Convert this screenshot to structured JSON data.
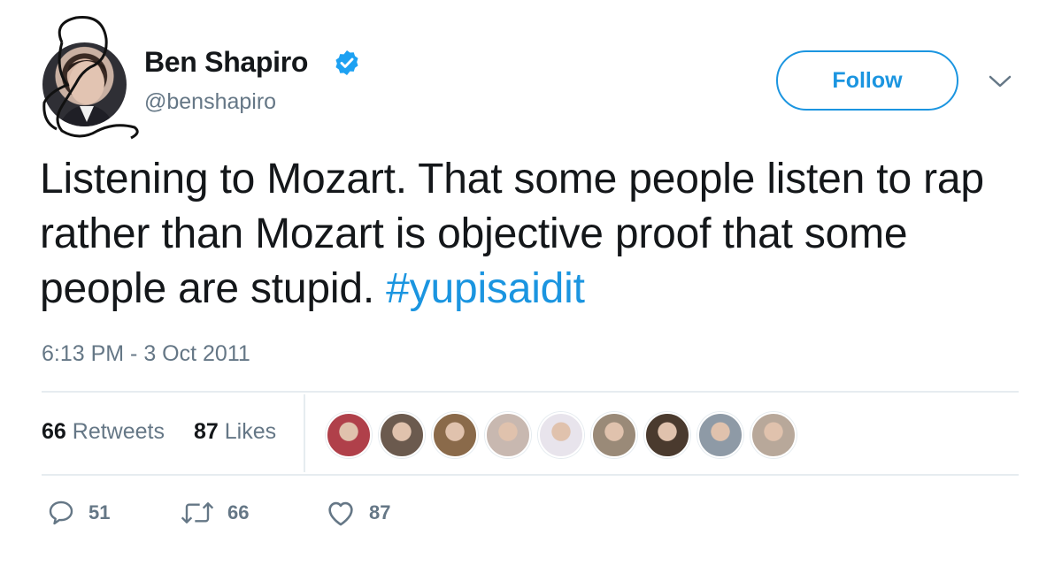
{
  "user": {
    "name": "Ben Shapiro",
    "handle": "@benshapiro",
    "verified_icon": "verified-badge-icon",
    "accent": "#1da1f2"
  },
  "follow_button": {
    "label": "Follow",
    "color": "#1b95e0"
  },
  "menu": {
    "icon": "chevron-down-icon"
  },
  "tweet": {
    "text_before_hashtag": "Listening to Mozart. That some people listen to rap rather than Mozart is objective proof that some people are stupid. ",
    "hashtag": "#yupisaidit",
    "timestamp": "6:13 PM - 3 Oct 2011"
  },
  "stats": {
    "retweets_count": "66",
    "retweets_label": "Retweets",
    "likes_count": "87",
    "likes_label": "Likes"
  },
  "likers": [
    {
      "icon": "liker-avatar-1",
      "color": "#b0404a"
    },
    {
      "icon": "liker-avatar-2",
      "color": "#6b5a4e"
    },
    {
      "icon": "liker-avatar-3",
      "color": "#8a6a4a"
    },
    {
      "icon": "liker-avatar-4",
      "color": "#c8b8b0"
    },
    {
      "icon": "liker-avatar-5",
      "color": "#e8e4ec"
    },
    {
      "icon": "liker-avatar-6",
      "color": "#9a8a78"
    },
    {
      "icon": "liker-avatar-7",
      "color": "#4a3a2e"
    },
    {
      "icon": "liker-avatar-8",
      "color": "#8e9aa6"
    },
    {
      "icon": "liker-avatar-9",
      "color": "#b8a89a"
    }
  ],
  "actions": {
    "reply": {
      "icon": "reply-icon",
      "count": "51"
    },
    "retweet": {
      "icon": "retweet-icon",
      "count": "66"
    },
    "like": {
      "icon": "heart-icon",
      "count": "87"
    }
  },
  "colors": {
    "text": "#14171a",
    "secondary": "#657786",
    "link": "#1b95e0",
    "divider": "#e6ecf0"
  }
}
